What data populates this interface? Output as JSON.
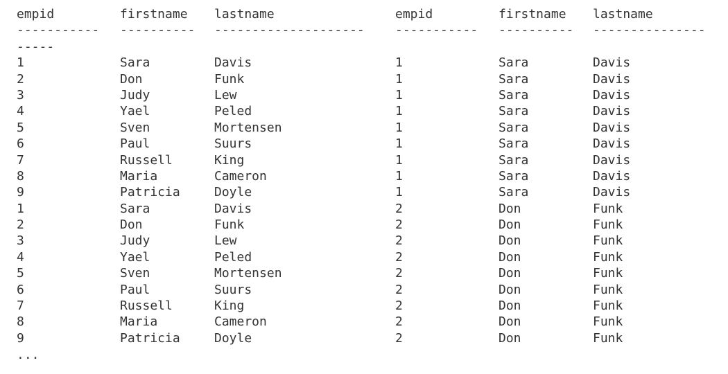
{
  "headers": [
    "empid",
    "firstname",
    "lastname",
    "empid",
    "firstname",
    "lastname"
  ],
  "separators": [
    "-----------",
    "----------",
    "--------------------",
    "-----------",
    "----------",
    "---------------"
  ],
  "separator_overflow": "-----",
  "rows": [
    [
      "1",
      "Sara",
      "Davis",
      "1",
      "Sara",
      "Davis"
    ],
    [
      "2",
      "Don",
      "Funk",
      "1",
      "Sara",
      "Davis"
    ],
    [
      "3",
      "Judy",
      "Lew",
      "1",
      "Sara",
      "Davis"
    ],
    [
      "4",
      "Yael",
      "Peled",
      "1",
      "Sara",
      "Davis"
    ],
    [
      "5",
      "Sven",
      "Mortensen",
      "1",
      "Sara",
      "Davis"
    ],
    [
      "6",
      "Paul",
      "Suurs",
      "1",
      "Sara",
      "Davis"
    ],
    [
      "7",
      "Russell",
      "King",
      "1",
      "Sara",
      "Davis"
    ],
    [
      "8",
      "Maria",
      "Cameron",
      "1",
      "Sara",
      "Davis"
    ],
    [
      "9",
      "Patricia",
      "Doyle",
      "1",
      "Sara",
      "Davis"
    ],
    [
      "1",
      "Sara",
      "Davis",
      "2",
      "Don",
      "Funk"
    ],
    [
      "2",
      "Don",
      "Funk",
      "2",
      "Don",
      "Funk"
    ],
    [
      "3",
      "Judy",
      "Lew",
      "2",
      "Don",
      "Funk"
    ],
    [
      "4",
      "Yael",
      "Peled",
      "2",
      "Don",
      "Funk"
    ],
    [
      "5",
      "Sven",
      "Mortensen",
      "2",
      "Don",
      "Funk"
    ],
    [
      "6",
      "Paul",
      "Suurs",
      "2",
      "Don",
      "Funk"
    ],
    [
      "7",
      "Russell",
      "King",
      "2",
      "Don",
      "Funk"
    ],
    [
      "8",
      "Maria",
      "Cameron",
      "2",
      "Don",
      "Funk"
    ],
    [
      "9",
      "Patricia",
      "Doyle",
      "2",
      "Don",
      "Funk"
    ]
  ],
  "ellipsis": "..."
}
